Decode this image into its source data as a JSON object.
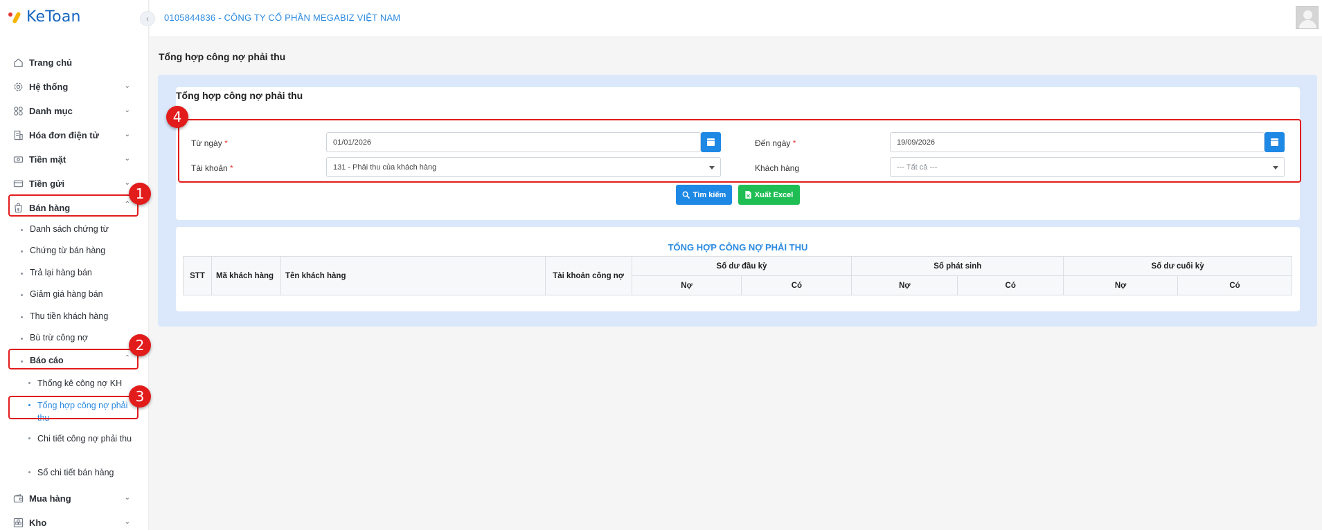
{
  "app": {
    "logo_text": "KeToan"
  },
  "header": {
    "company": "0105844836 - CÔNG TY CỔ PHẦN MEGABIZ VIỆT NAM"
  },
  "sidebar": {
    "items": [
      {
        "label": "Trang chủ",
        "icon": "home-icon"
      },
      {
        "label": "Hệ thống",
        "icon": "gear-icon"
      },
      {
        "label": "Danh mục",
        "icon": "grid-icon"
      },
      {
        "label": "Hóa đơn điện tử",
        "icon": "invoice-icon"
      },
      {
        "label": "Tiền mặt",
        "icon": "cash-icon"
      },
      {
        "label": "Tiền gửi",
        "icon": "bank-card-icon"
      },
      {
        "label": "Bán hàng",
        "icon": "sales-bag-icon"
      }
    ],
    "sales_sub": [
      "Danh sách chứng từ",
      "Chứng từ bán hàng",
      "Trả lại hàng bán",
      "Giảm giá hàng bán",
      "Thu tiền khách hàng",
      "Bù trừ công nợ",
      "Báo cáo"
    ],
    "report_sub": [
      "Thống kê công nợ KH",
      "Tổng hợp công nợ phải thu",
      "Chi tiết công nợ phải thu",
      "Sổ chi tiết bán hàng"
    ],
    "bottom_items": [
      {
        "label": "Mua hàng",
        "icon": "wallet-icon"
      },
      {
        "label": "Kho",
        "icon": "warehouse-icon"
      }
    ]
  },
  "callouts": [
    "1",
    "2",
    "3",
    "4"
  ],
  "page": {
    "title": "Tổng hợp công nợ phải thu",
    "card_title": "Tổng hợp công nợ phải thu"
  },
  "filters": {
    "from_date_label": "Từ ngày",
    "from_date_value": "01/01/2026",
    "to_date_label": "Đến ngày",
    "to_date_value": "19/09/2026",
    "account_label": "Tài khoản",
    "account_value": "131 - Phải thu của khách hàng",
    "customer_label": "Khách hàng",
    "customer_placeholder": "--- Tất cả ---",
    "required_mark": "*"
  },
  "buttons": {
    "search": "Tìm kiếm",
    "excel": "Xuất Excel"
  },
  "report": {
    "title": "TỔNG HỢP CÔNG NỢ PHẢI THU",
    "columns": {
      "stt": "STT",
      "customer_code": "Mã khách hàng",
      "customer_name": "Tên khách hàng",
      "debt_account": "Tài khoản công nợ",
      "opening": "Số dư đầu kỳ",
      "period": "Số phát sinh",
      "closing": "Số dư cuối kỳ",
      "debit": "Nợ",
      "credit": "Có"
    }
  }
}
